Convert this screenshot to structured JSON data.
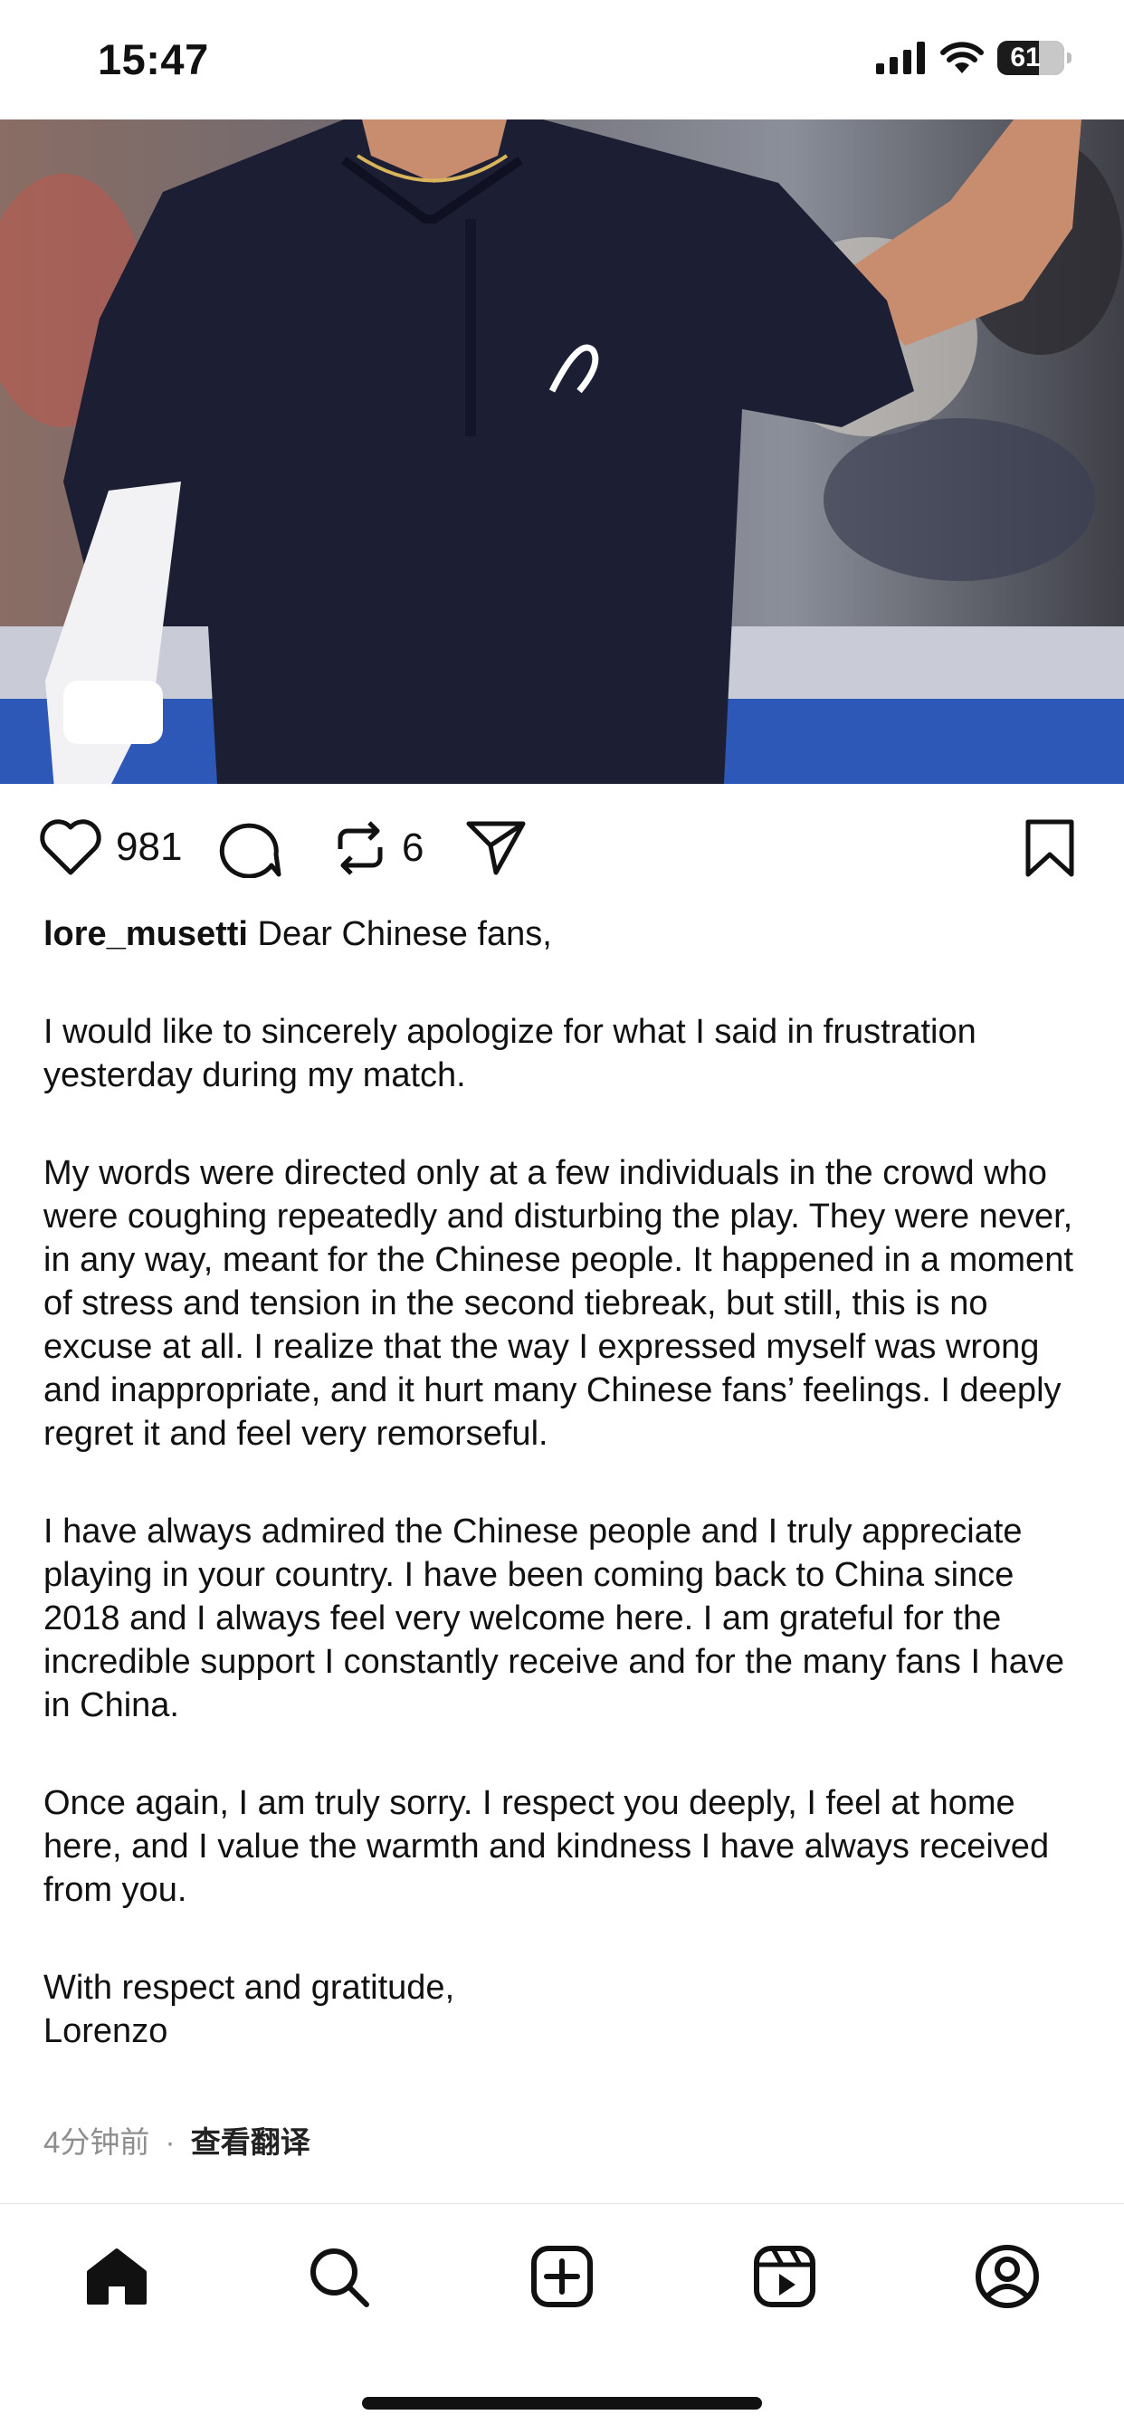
{
  "status_bar": {
    "time": "15:47",
    "battery": "61"
  },
  "post": {
    "likes": "981",
    "reposts": "6",
    "username": "lore_musetti",
    "caption_lead": "Dear Chinese fans,",
    "paragraphs": [
      "I would like to sincerely apologize for what I said in frustration yesterday during my match.",
      "My words were directed only at a few individuals in the crowd who were coughing repeatedly and disturbing the play. They were never, in any way, meant for the Chinese people. It happened in a moment of stress and tension in the second tiebreak, but still, this is no excuse at all. I realize that the way I expressed myself was wrong and inappropriate, and it hurt many Chinese fans’ feelings. I deeply regret it and feel very remorseful.",
      "I have always admired the Chinese people and I truly appreciate playing in your country.  I have been coming back to China since 2018 and I always feel very welcome here. I am grateful for the incredible support I constantly receive and for the many fans I have in China.",
      "Once again, I am truly sorry. I respect you deeply, I feel at home here, and I value the warmth and kindness I have always received from you."
    ],
    "signoff_line1": "With respect and gratitude,",
    "signoff_line2": "Lorenzo",
    "time_ago": "4分钟前",
    "separator": "·",
    "translate_label": "查看翻译"
  },
  "tabs": {
    "home": "home-icon",
    "search": "search-icon",
    "create": "create-icon",
    "reels": "reels-icon",
    "profile": "profile-icon"
  },
  "colors": {
    "text": "#111111",
    "muted": "#8e8e8e",
    "shirt": "#1c1f33"
  }
}
